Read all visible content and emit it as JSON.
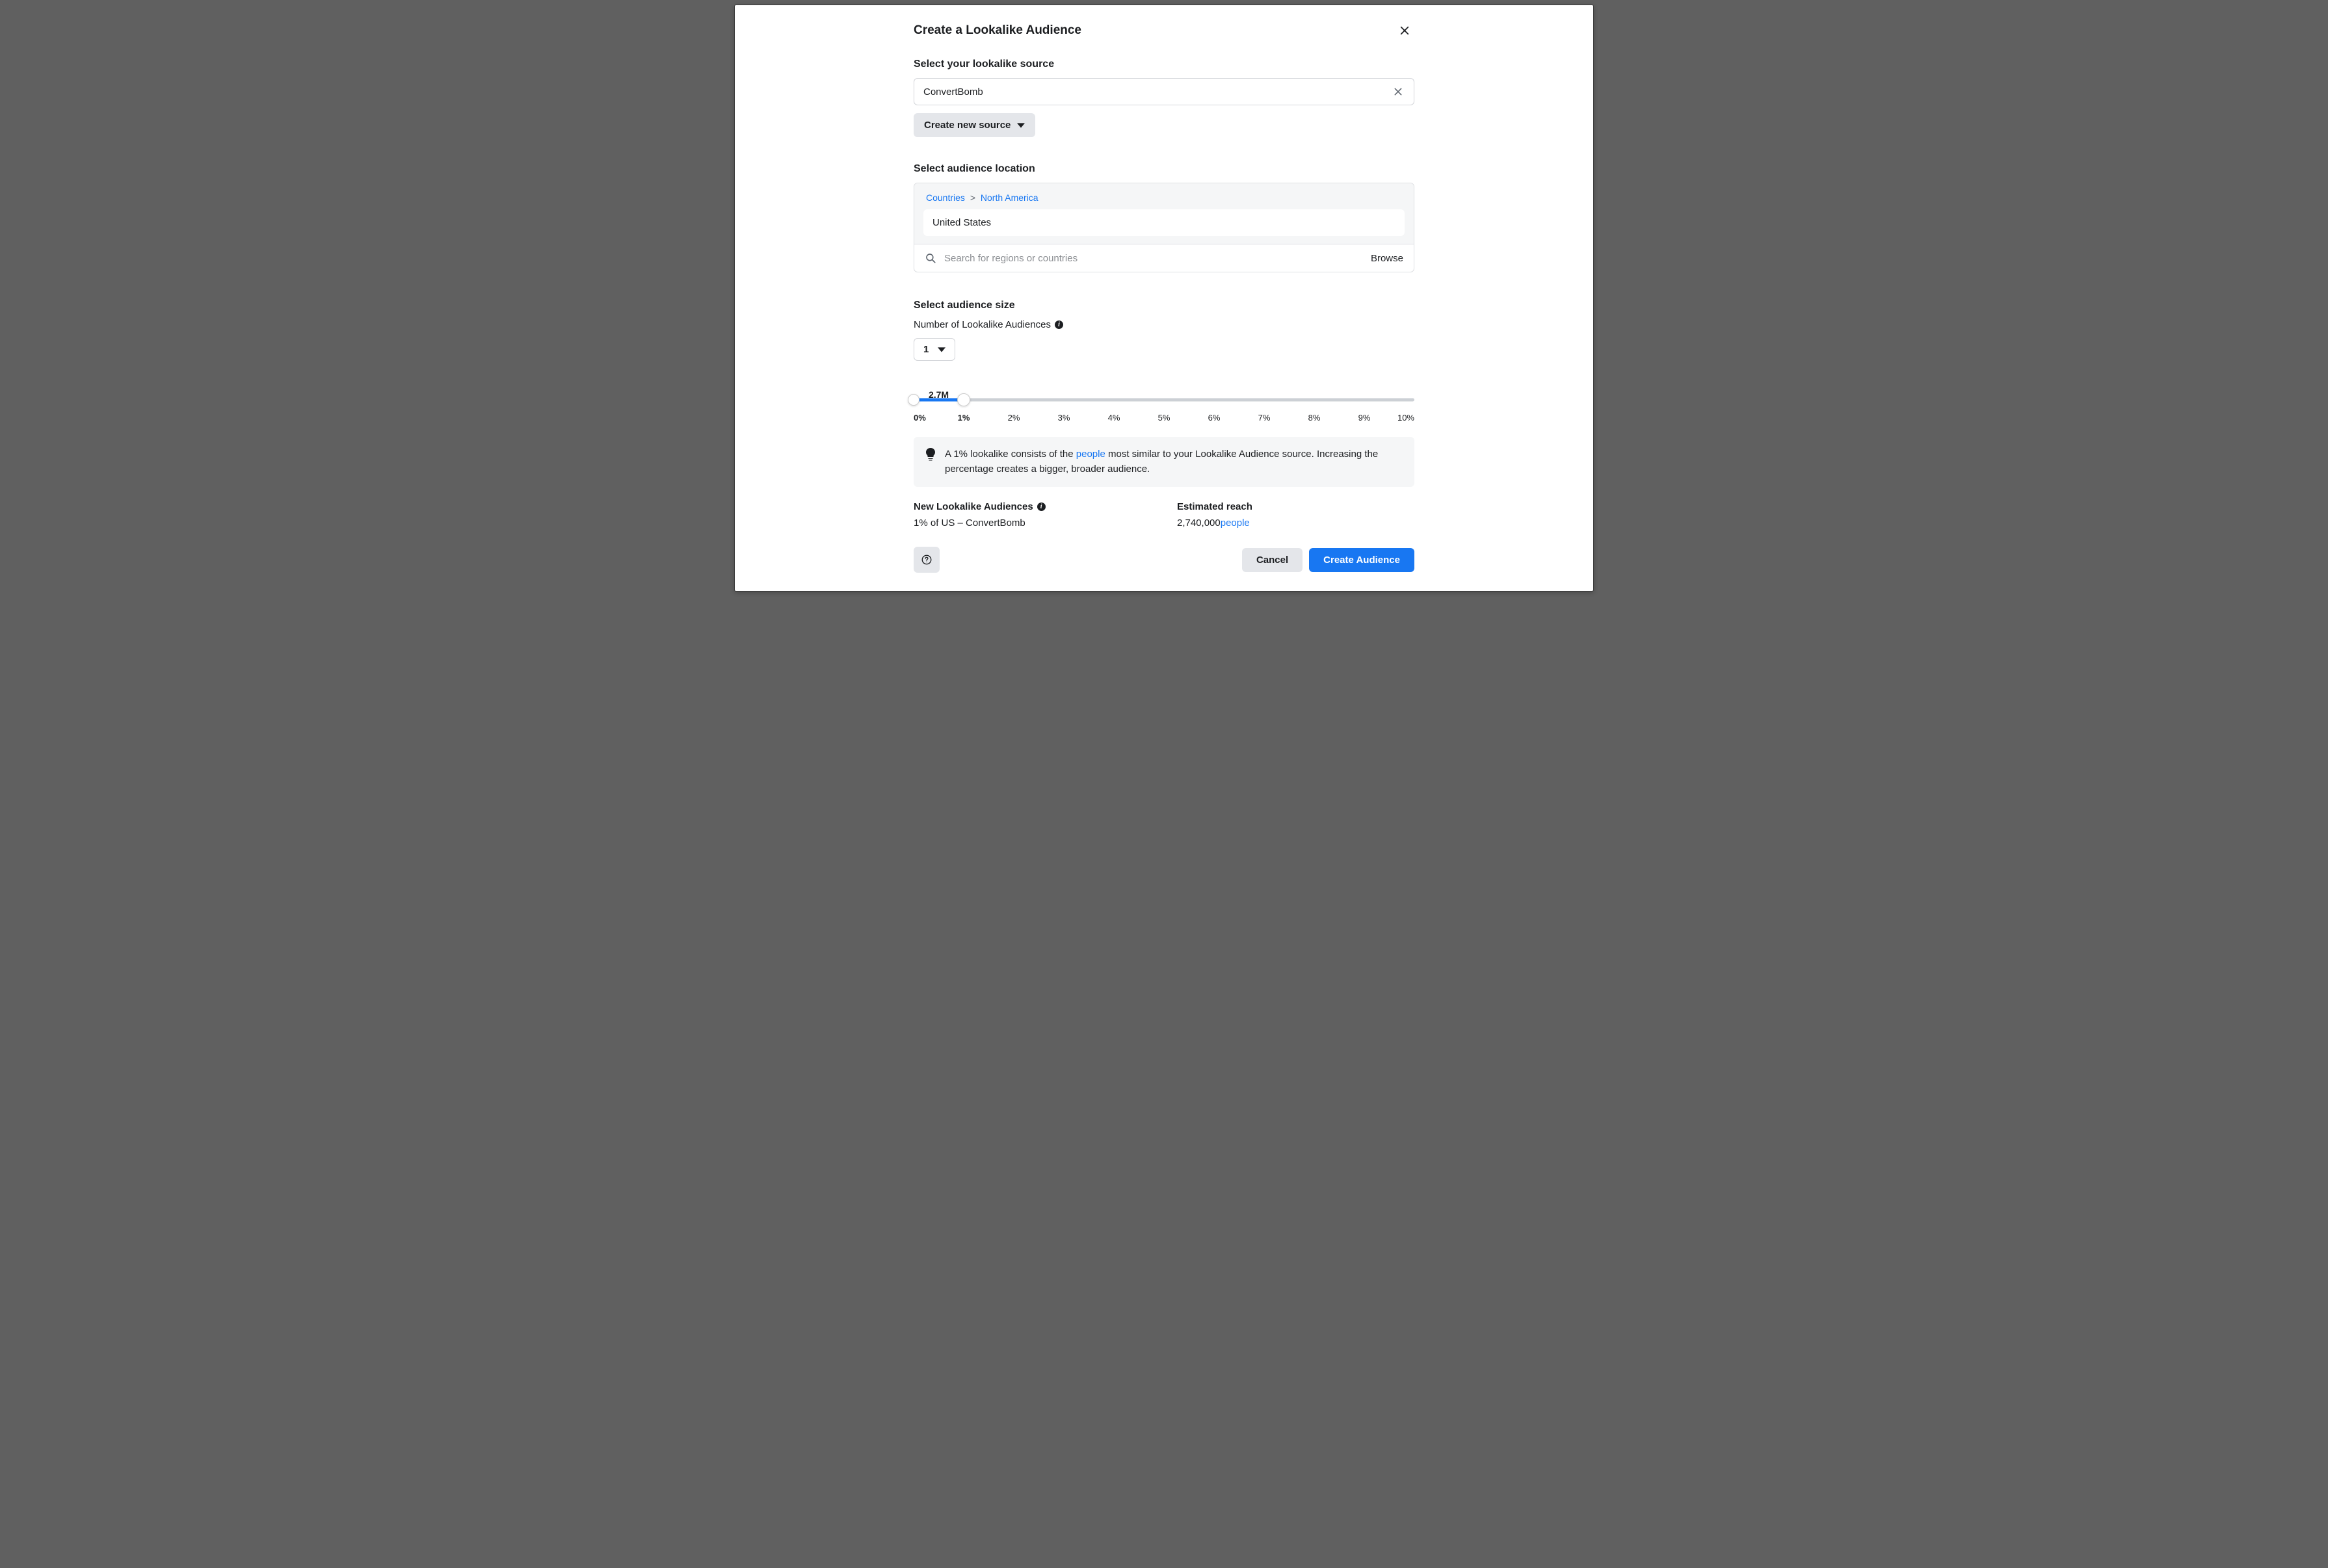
{
  "modal": {
    "title": "Create a Lookalike Audience"
  },
  "source": {
    "heading": "Select your lookalike source",
    "value": "ConvertBomb",
    "create_new_label": "Create new source"
  },
  "location": {
    "heading": "Select audience location",
    "breadcrumb": {
      "root": "Countries",
      "region": "North America"
    },
    "selected": "United States",
    "search_placeholder": "Search for regions or countries",
    "browse_label": "Browse"
  },
  "size": {
    "heading": "Select audience size",
    "count_label": "Number of Lookalike Audiences",
    "count_value": "1",
    "slider": {
      "value_label": "2.7M",
      "min_pct": "0%",
      "selected_pct": "1%",
      "fill_percent": 10,
      "ticks": [
        "0%",
        "1%",
        "2%",
        "3%",
        "4%",
        "5%",
        "6%",
        "7%",
        "8%",
        "9%",
        "10%"
      ]
    },
    "info_text_1": "A 1% lookalike consists of the ",
    "info_link": "people",
    "info_text_2": " most similar to your Lookalike Audience source. Increasing the percentage creates a bigger, broader audience."
  },
  "summary": {
    "new_heading": "New Lookalike Audiences",
    "new_value": "1% of US – ConvertBomb",
    "reach_heading": "Estimated reach",
    "reach_value": "2,740,000",
    "reach_suffix": "people"
  },
  "footer": {
    "cancel": "Cancel",
    "create": "Create Audience"
  }
}
